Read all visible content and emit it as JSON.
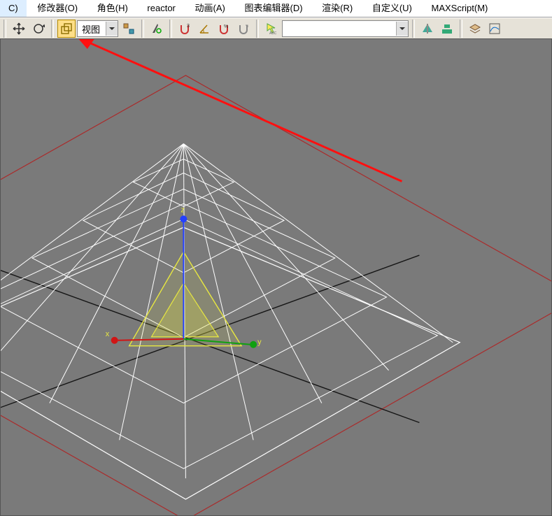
{
  "menu": {
    "items": [
      {
        "label": "C)"
      },
      {
        "label": "修改器(O)"
      },
      {
        "label": "角色(H)"
      },
      {
        "label": "reactor"
      },
      {
        "label": "动画(A)"
      },
      {
        "label": "图表编辑器(D)"
      },
      {
        "label": "渲染(R)"
      },
      {
        "label": "自定义(U)"
      },
      {
        "label": "MAXScript(M)"
      }
    ]
  },
  "toolbar": {
    "coord_system_value": "视图",
    "selection_filter_value": ""
  },
  "gizmo": {
    "x": "x",
    "y": "y",
    "z": "z"
  }
}
